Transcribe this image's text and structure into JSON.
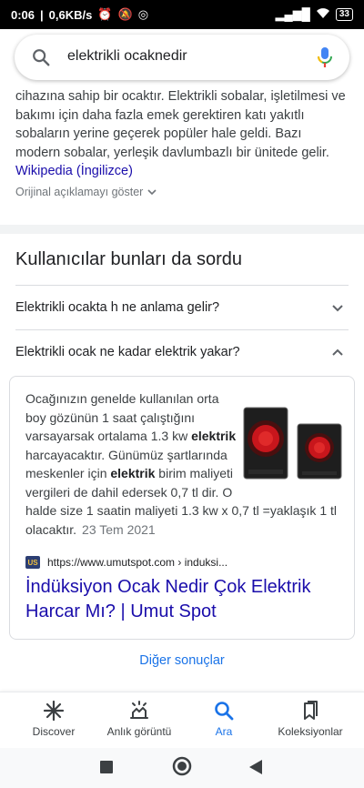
{
  "status_bar": {
    "time": "0:06",
    "net_speed": "0,6KB/s",
    "battery": "33"
  },
  "search": {
    "query": "elektrikli ocaknedir",
    "icon": "search-icon",
    "mic_icon": "mic-icon"
  },
  "snippet": {
    "text": "cihazına sahip bir ocaktır. Elektrikli sobalar, işletilmesi ve bakımı için daha fazla emek gerektiren katı yakıtlı sobaların yerine geçerek popüler hale geldi. Bazı modern sobalar, yerleşik davlumbazlı bir ünitede gelir. ",
    "link": "Wikipedia (İngilizce)",
    "show_original": "Orijinal açıklamayı göster"
  },
  "people_also_ask": {
    "title": "Kullanıcılar bunları da sordu",
    "questions": [
      {
        "text": "Elektrikli ocakta h ne anlama gelir?",
        "expanded": false
      },
      {
        "text": "Elektrikli ocak ne kadar elektrik yakar?",
        "expanded": true
      }
    ]
  },
  "answer": {
    "part1": "Ocağınızın genelde kullanılan orta boy gözünün 1 saat çalıştığını varsayarsak ortalama 1.3 kw ",
    "bold1": "elektrik",
    "part2": " harcayacaktır. Günümüz şartlarında meskenler için ",
    "bold2": "elektrik",
    "part3": " birim maliyeti vergileri de dahil edersek 0,7 tl dir. O halde size 1 saatin maliyeti 1.3 kw x 0,7 tl =yaklaşık 1 tl olacaktır.",
    "date": "23 Tem 2021",
    "source_favicon": "US",
    "source_url": "https://www.umutspot.com › induksi...",
    "result_title": "İndüksiyon Ocak Nedir Çok Elektrik Harcar Mı? | Umut Spot"
  },
  "more_results": "Diğer sonuçlar",
  "bottom_nav": [
    {
      "label": "Discover",
      "icon": "asterisk-icon",
      "active": false
    },
    {
      "label": "Anlık görüntü",
      "icon": "snapshot-icon",
      "active": false
    },
    {
      "label": "Ara",
      "icon": "search-icon",
      "active": true
    },
    {
      "label": "Koleksiyonlar",
      "icon": "bookmarks-icon",
      "active": false
    }
  ],
  "colors": {
    "accent": "#1a73e8",
    "link": "#1a0dab",
    "text": "#202124",
    "secondary": "#70757a"
  }
}
